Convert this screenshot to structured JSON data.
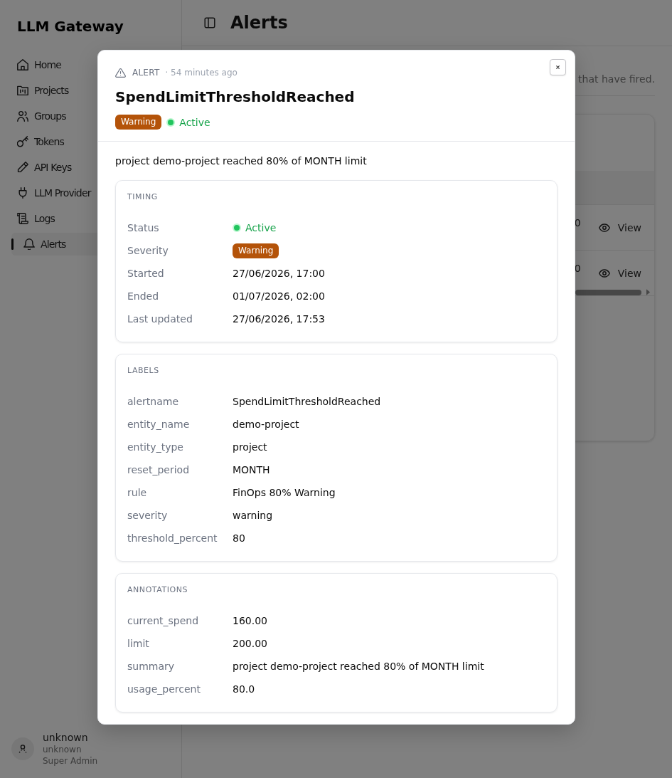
{
  "sidebar": {
    "title": "LLM Gateway",
    "items": [
      {
        "label": "Home",
        "selected": false
      },
      {
        "label": "Projects",
        "selected": false
      },
      {
        "label": "Groups",
        "selected": false
      },
      {
        "label": "Tokens",
        "selected": false
      },
      {
        "label": "API Keys",
        "selected": false
      },
      {
        "label": "LLM Provider",
        "selected": false
      },
      {
        "label": "Logs",
        "selected": false
      },
      {
        "label": "Alerts",
        "selected": true
      }
    ],
    "user": {
      "name": "unknown",
      "username": "unknown",
      "role": "Super Admin"
    }
  },
  "header": {
    "title": "Alerts"
  },
  "page": {
    "description": "that have fired.",
    "table": {
      "rows": [
        {
          "column_1": "0",
          "action": "View"
        },
        {
          "column_1": "0",
          "action": "View"
        }
      ]
    }
  },
  "modal": {
    "kicker": "ALERT",
    "time": "· 54 minutes ago",
    "title": "SpendLimitThresholdReached",
    "severity": "Warning",
    "status": "Active",
    "summary": "project demo-project reached 80% of MONTH limit",
    "sections": [
      {
        "title": "TIMING",
        "rows": [
          {
            "kind": "status",
            "label": "Status",
            "value": "Active"
          },
          {
            "kind": "badge",
            "label": "Severity",
            "value": "Warning"
          },
          {
            "kind": "text",
            "label": "Started",
            "value": "27/06/2026, 17:00"
          },
          {
            "kind": "text",
            "label": "Ended",
            "value": "01/07/2026, 02:00"
          },
          {
            "kind": "text",
            "label": "Last updated",
            "value": "27/06/2026, 17:53"
          }
        ]
      },
      {
        "title": "LABELS",
        "rows": [
          {
            "kind": "text",
            "label": "alertname",
            "value": "SpendLimitThresholdReached"
          },
          {
            "kind": "text",
            "label": "entity_name",
            "value": "demo-project"
          },
          {
            "kind": "text",
            "label": "entity_type",
            "value": "project"
          },
          {
            "kind": "text",
            "label": "reset_period",
            "value": "MONTH"
          },
          {
            "kind": "text",
            "label": "rule",
            "value": "FinOps 80% Warning"
          },
          {
            "kind": "text",
            "label": "severity",
            "value": "warning"
          },
          {
            "kind": "text",
            "label": "threshold_percent",
            "value": "80"
          }
        ]
      },
      {
        "title": "ANNOTATIONS",
        "rows": [
          {
            "kind": "text",
            "label": "current_spend",
            "value": "160.00"
          },
          {
            "kind": "text",
            "label": "limit",
            "value": "200.00"
          },
          {
            "kind": "text",
            "label": "summary",
            "value": "project demo-project reached 80% of MONTH limit"
          },
          {
            "kind": "text",
            "label": "usage_percent",
            "value": "80.0"
          }
        ]
      }
    ]
  }
}
